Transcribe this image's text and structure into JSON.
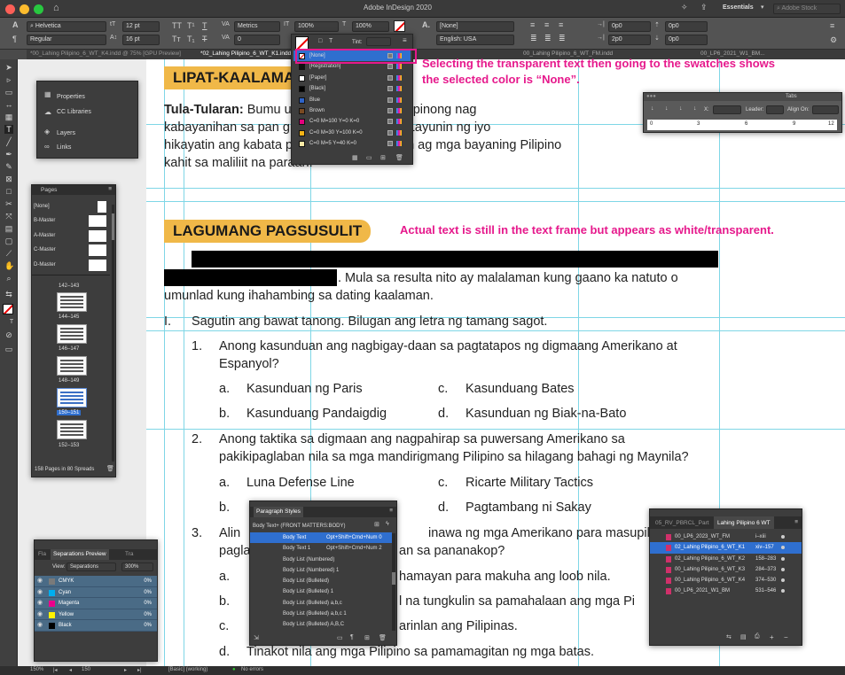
{
  "app": {
    "title": "Adobe InDesign 2020",
    "workspace": "Essentials",
    "search_placeholder": "Adobe Stock"
  },
  "control": {
    "font": "Helvetica",
    "style": "Regular",
    "size": "12 pt",
    "leading": "16 pt",
    "kerning": "Metrics",
    "tracking": "0",
    "hscale": "100%",
    "vscale": "100%",
    "char_style": "[None]",
    "language": "English: USA",
    "base_shift": "0 pt",
    "skew": "0°",
    "indent1": "0p0",
    "indent2": "0p0",
    "indent3": "0p0",
    "indent4": "0p0",
    "space1": "2p0",
    "space2": "0p0",
    "tint_label": "Tint:"
  },
  "tabs": [
    "*00_Lahing Pilipino_6_WT_K4.indd @ 75% [GPU Preview]",
    "*02_Lahing Pilipino_6_WT_K1.indd",
    "00_Lahing Pilipino_6_WT_FM.indd",
    "00_LP6_2021_W1_BM..."
  ],
  "swatches": [
    {
      "name": "[None]",
      "color": "none"
    },
    {
      "name": "[Registration]",
      "color": "#111111"
    },
    {
      "name": "[Paper]",
      "color": "#ffffff"
    },
    {
      "name": "[Black]",
      "color": "#000000"
    },
    {
      "name": "Blue",
      "color": "#2e64c8"
    },
    {
      "name": "Brown",
      "color": "#7a4a22"
    },
    {
      "name": "C=0 M=100 Y=0 K=0",
      "color": "#e6007e"
    },
    {
      "name": "C=0 M=30 Y=100 K=0",
      "color": "#f6b417"
    },
    {
      "name": "C=0 M=5 Y=40 K=0",
      "color": "#fdeaa6"
    }
  ],
  "annotations": {
    "swatch_note_1": "Selecting the transparent text then going to the swatches shows",
    "swatch_note_2": "the selected color is “None”.",
    "text_note": "Actual text is still in the text frame but appears as white/transparent."
  },
  "left_panel": {
    "items": [
      "Properties",
      "CC Libraries",
      "Layers",
      "Links"
    ]
  },
  "pages_panel": {
    "title": "Pages",
    "masters": [
      "[None]",
      "B-Master",
      "A-Master",
      "C-Master",
      "D-Master"
    ],
    "spreads": [
      "142–143",
      "144–145",
      "146–147",
      "148–149",
      "150–151",
      "152–153"
    ],
    "footer": "158 Pages in 80 Spreads"
  },
  "tabs_panel": {
    "title": "Tabs",
    "x_label": "X:",
    "leader_label": "Leader:",
    "align_label": "Align On:",
    "ruler": [
      "0",
      "3",
      "6",
      "9",
      "12"
    ]
  },
  "sep_panel": {
    "tabs": [
      "Fla",
      "Separations Preview",
      "Tra"
    ],
    "view_label": "View:",
    "view_value": "Separations",
    "zoom": "300%",
    "inks": [
      {
        "name": "CMYK",
        "pct": "0%",
        "color": "#7a7a7a"
      },
      {
        "name": "Cyan",
        "pct": "0%",
        "color": "#00aeef"
      },
      {
        "name": "Magenta",
        "pct": "0%",
        "color": "#ec008c"
      },
      {
        "name": "Yellow",
        "pct": "0%",
        "color": "#fff200"
      },
      {
        "name": "Black",
        "pct": "0%",
        "color": "#000000"
      }
    ]
  },
  "para_panel": {
    "title": "Paragraph Styles",
    "current": "Body Text+ (FRONT MATTERS:BODY)",
    "styles": [
      {
        "name": "Body Text",
        "shortcut": "Opt+Shift+Cmd+Num 0"
      },
      {
        "name": "Body Text 1",
        "shortcut": "Opt+Shift+Cmd+Num 2"
      },
      {
        "name": "Body List (Numbered)",
        "shortcut": ""
      },
      {
        "name": "Body List (Numbered) 1",
        "shortcut": ""
      },
      {
        "name": "Body List (Bulleted)",
        "shortcut": ""
      },
      {
        "name": "Body List (Bulleted) 1",
        "shortcut": ""
      },
      {
        "name": "Body List (Bulleted) a,b,c",
        "shortcut": ""
      },
      {
        "name": "Body List (Bulleted) a,b,c 1",
        "shortcut": ""
      },
      {
        "name": "Body List (Bulleted) A,B,C",
        "shortcut": ""
      }
    ]
  },
  "book_panel": {
    "tabs": [
      "05_RV_PBRCL_Part",
      "Lahing Pilipino 6 WT"
    ],
    "docs": [
      {
        "name": "00_LP6_2023_WT_FM",
        "pages": "i–xiii"
      },
      {
        "name": "02_Lahing Pilipino_6_WT_K1",
        "pages": "xiv–157"
      },
      {
        "name": "02_Lahing Pilipino_6_WT_K2",
        "pages": "158–283"
      },
      {
        "name": "00_Lahing Pilipino_6_WT_K3",
        "pages": "284–373"
      },
      {
        "name": "00_Lahing Pilipino_6_WT_K4",
        "pages": "374–530"
      },
      {
        "name": "00_LP6_2021_W1_BM",
        "pages": "531–546"
      }
    ]
  },
  "doc": {
    "heading1": "LIPAT-KAALAMAN",
    "p1_bold": "Tula-Tularan:",
    "p1_l1": "Bumu                          ula tungkol sa mga Pilipinong nag",
    "p1_l2": "kabayanihan sa pan                      g Pilipino-Amerikano. Layunin ng iyo",
    "p1_l3": "hikayatin ang kabata                    pakita ng kabayanihan ag mga bayaning Pilipino",
    "p1_l4": "kahit sa maliliit na paraan.",
    "heading2": "LAGUMANG PAGSUSULIT",
    "p2_tail": ". Mula sa resulta nito ay malalaman kung gaano ka natuto o",
    "p2_l2": "umunlad kung ihahambing sa dating kaalaman.",
    "roman": "I.",
    "instruction": "Sagutin ang bawat tanong. Bilugan ang letra ng tamang sagot.",
    "q1_num": "1.",
    "q1_l1": "Anong kasunduan ang nagbigay-daan sa pagtatapos ng digmaang Amerikano at",
    "q1_l2": "Espanyol?",
    "q1_choices": [
      "a.",
      "Kasunduan ng Paris",
      "c.",
      "Kasunduang Bates",
      "b.",
      "Kasunduang Pandaigdig",
      "d.",
      "Kasunduan ng Biak-na-Bato"
    ],
    "q2_num": "2.",
    "q2_l1": "Anong taktika sa digmaan ang nagpahirap sa puwersang Amerikano sa",
    "q2_l2": "pakikipaglaban nila sa mga mandirigmang Pilipino sa hilagang bahagi ng Maynila?",
    "q2_choices": [
      "a.",
      "Luna Defense Line",
      "c.",
      "Ricarte Military Tactics",
      "b.",
      "d.",
      "Pagtambang ni Sakay"
    ],
    "q3_num": "3.",
    "q3_l1a": "Alin",
    "q3_l1b": "inawa ng mga Amerikano para masupil ang",
    "q3_l2a": "pagla",
    "q3_l2b": "an sa pananakop?",
    "q3_a": "a.",
    "q3_a_text": "hamayan para makuha ang loob nila.",
    "q3_b": "b.",
    "q3_b_text": "l na tungkulin sa pamahalaan ang mga Pi",
    "q3_c": "c.",
    "q3_c_text": "arinlan ang Pilipinas.",
    "q3_d": "d.",
    "q3_d_text": "Tinakot nila ang mga Pilipino sa pamamagitan ng mga batas."
  },
  "status": {
    "zoom": "150%",
    "page": "150",
    "style": "[Basic] (working)",
    "errors": "No errors"
  }
}
